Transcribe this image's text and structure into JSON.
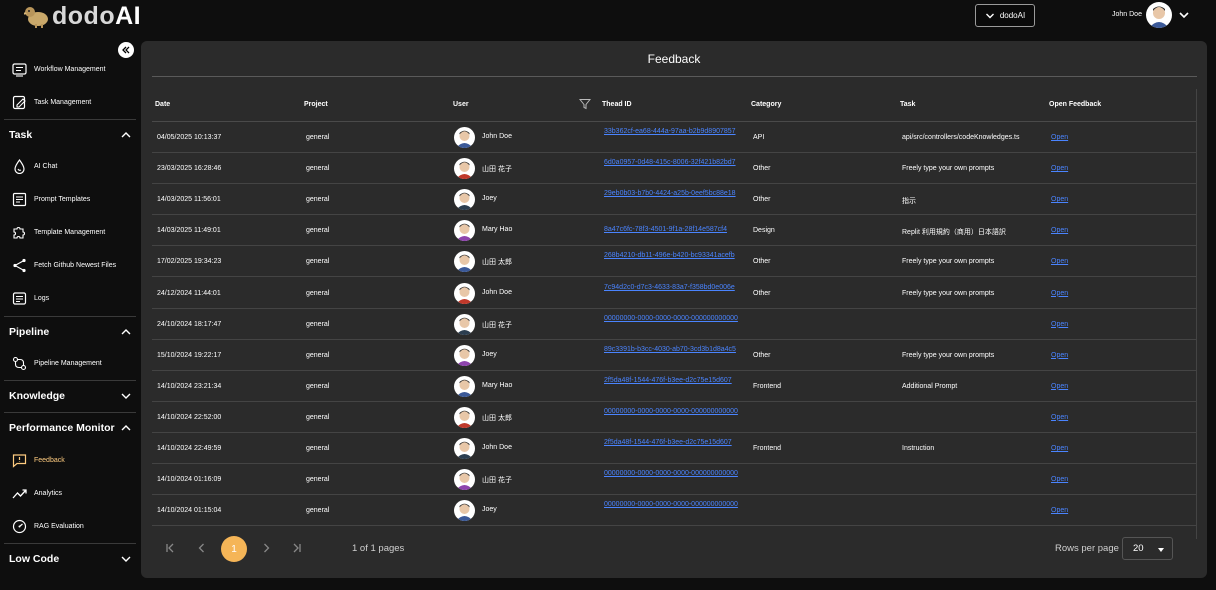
{
  "app": {
    "logo_text_a": "dodo",
    "logo_text_b": "AI",
    "workspace_label": "dodoAI",
    "user_name": "John Doe"
  },
  "sidebar": {
    "items_top": [
      {
        "label": "Workflow Management",
        "icon": "workflow-icon"
      },
      {
        "label": "Task Management",
        "icon": "task-edit-icon"
      }
    ],
    "sections": [
      {
        "label": "Task",
        "expanded": true,
        "items": [
          {
            "label": "AI Chat",
            "icon": "drop-icon"
          },
          {
            "label": "Prompt Templates",
            "icon": "template-icon"
          },
          {
            "label": "Template Management",
            "icon": "puzzle-icon"
          },
          {
            "label": "Fetch Github Newest Files",
            "icon": "share-icon"
          },
          {
            "label": "Logs",
            "icon": "logs-icon"
          }
        ]
      },
      {
        "label": "Pipeline",
        "expanded": true,
        "items": [
          {
            "label": "Pipeline Management",
            "icon": "pipeline-icon"
          }
        ]
      },
      {
        "label": "Knowledge",
        "expanded": false,
        "items": []
      },
      {
        "label": "Performance Monitor",
        "expanded": true,
        "items": [
          {
            "label": "Feedback",
            "icon": "feedback-icon",
            "active": true
          },
          {
            "label": "Analytics",
            "icon": "analytics-icon"
          },
          {
            "label": "RAG Evaluation",
            "icon": "gauge-icon"
          }
        ]
      },
      {
        "label": "Low Code",
        "expanded": false,
        "items": []
      }
    ]
  },
  "main": {
    "title": "Feedback",
    "columns": [
      "Date",
      "Project",
      "User",
      "Thead ID",
      "Category",
      "Task",
      "Open Feedback"
    ],
    "rows": [
      {
        "date": "04/05/2025 10:13:37",
        "project": "general",
        "user": "John Doe",
        "thread": "33b362cf-ea68-444a-97aa-b2b9d8907857",
        "category": "API",
        "task": "api/src/controllers/codeKnowledges.ts",
        "open": "Open"
      },
      {
        "date": "23/03/2025 16:28:46",
        "project": "general",
        "user": "山田 花子",
        "thread": "6d0a0957-0d48-415c-8006-32f421b82bd7",
        "category": "Other",
        "task": "Freely type your own prompts",
        "open": "Open"
      },
      {
        "date": "14/03/2025 11:56:01",
        "project": "general",
        "user": "Joey",
        "thread": "29eb0b03-b7b0-4424-a25b-0eef5bc88e18",
        "category": "Other",
        "task": "指示",
        "open": "Open"
      },
      {
        "date": "14/03/2025 11:49:01",
        "project": "general",
        "user": "Mary Hao",
        "thread": "8a47c6fc-78f3-4501-9f1a-28f14e587cf4",
        "category": "Design",
        "task": "Replit 利用規約（商用）日本語訳",
        "open": "Open"
      },
      {
        "date": "17/02/2025 19:34:23",
        "project": "general",
        "user": "山田 太郎",
        "thread": "268b4210-db11-496e-b420-bc93341acefb",
        "category": "Other",
        "task": "Freely type your own prompts",
        "open": "Open"
      },
      {
        "date": "24/12/2024 11:44:01",
        "project": "general",
        "user": "John Doe",
        "thread": "7c94d2c0-d7c3-4633-83a7-f358bd0e006e",
        "category": "Other",
        "task": "Freely type your own prompts",
        "open": "Open"
      },
      {
        "date": "24/10/2024 18:17:47",
        "project": "general",
        "user": "山田 花子",
        "thread": "00000000-0000-0000-0000-000000000000",
        "category": "",
        "task": "",
        "open": "Open"
      },
      {
        "date": "15/10/2024 19:22:17",
        "project": "general",
        "user": "Joey",
        "thread": "89c3391b-b3cc-4030-ab70-3cd3b1d8a4c5",
        "category": "Other",
        "task": "Freely type your own prompts",
        "open": "Open"
      },
      {
        "date": "14/10/2024 23:21:34",
        "project": "general",
        "user": "Mary Hao",
        "thread": "2f5da48f-1544-476f-b3ee-d2c75e15d607",
        "category": "Frontend",
        "task": "Additional Prompt",
        "open": "Open"
      },
      {
        "date": "14/10/2024 22:52:00",
        "project": "general",
        "user": "山田 太郎",
        "thread": "00000000-0000-0000-0000-000000000000",
        "category": "",
        "task": "",
        "open": "Open"
      },
      {
        "date": "14/10/2024 22:49:59",
        "project": "general",
        "user": "John Doe",
        "thread": "2f5da48f-1544-476f-b3ee-d2c75e15d607",
        "category": "Frontend",
        "task": "Instruction",
        "open": "Open"
      },
      {
        "date": "14/10/2024 01:16:09",
        "project": "general",
        "user": "山田 花子",
        "thread": "00000000-0000-0000-0000-000000000000",
        "category": "",
        "task": "",
        "open": "Open"
      },
      {
        "date": "14/10/2024 01:15:04",
        "project": "general",
        "user": "Joey",
        "thread": "00000000-0000-0000-0000-000000000000",
        "category": "",
        "task": "",
        "open": "Open"
      }
    ],
    "pagination": {
      "current_page": "1",
      "page_info": "1 of 1 pages",
      "rows_per_page_label": "Rows per page",
      "rows_per_page": "20"
    }
  },
  "colors": {
    "accent": "#f5b557",
    "link": "#4a84ff",
    "active_nav": "#ffcc80",
    "panel": "#2b2b2b",
    "background": "#0e0e0e"
  }
}
